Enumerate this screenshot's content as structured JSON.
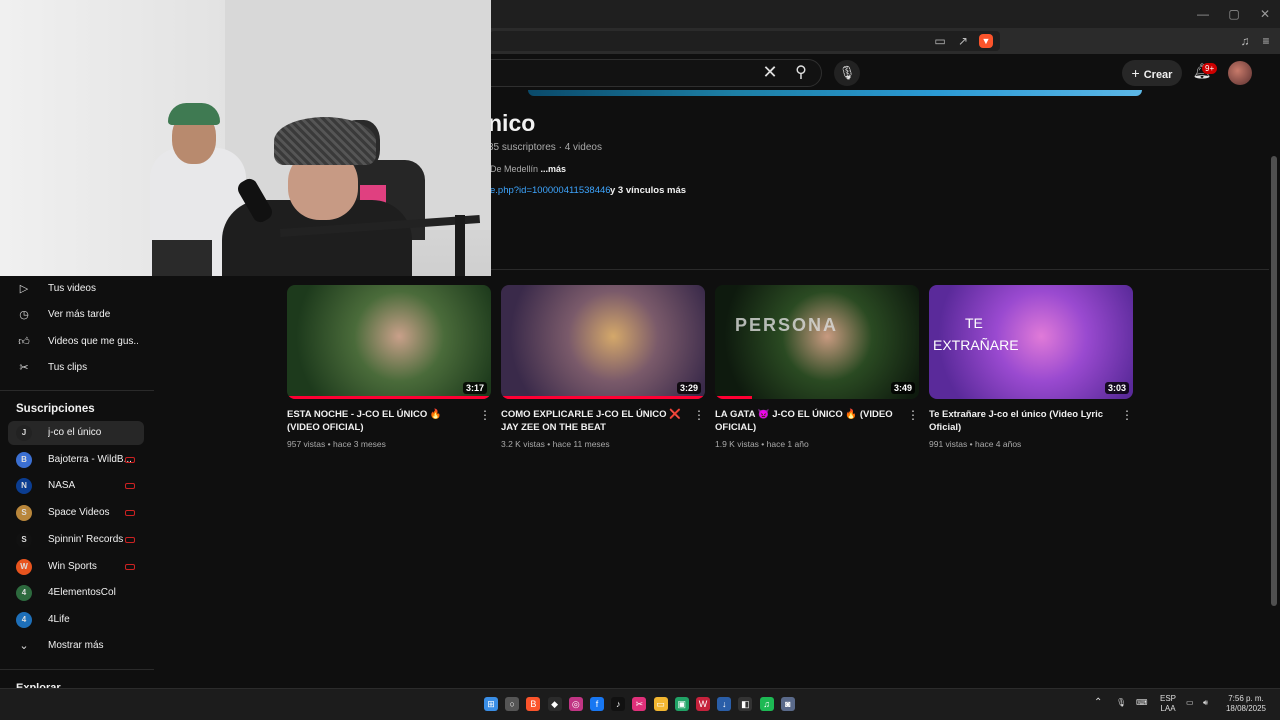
{
  "browser": {
    "window_controls": {
      "minimize": "—",
      "maximize": "▢",
      "close": "✕"
    }
  },
  "header": {
    "create_label": "Crear",
    "notifications_badge": "9+"
  },
  "channel": {
    "name": "nico",
    "stats": "35 suscriptores · 4 videos",
    "description": "De Medellín",
    "description_more": "...más",
    "link": "e.php?id=100000411538446",
    "more_links": "y 3 vínculos más"
  },
  "sidebar": {
    "items": [
      {
        "label": "Tus videos",
        "icon": "video-icon"
      },
      {
        "label": "Ver más tarde",
        "icon": "clock-icon"
      },
      {
        "label": "Videos que me gus...",
        "icon": "thumbs-up-icon"
      },
      {
        "label": "Tus clips",
        "icon": "scissors-icon"
      }
    ],
    "subscriptions_header": "Suscripciones",
    "subscriptions": [
      {
        "label": "j-co el único",
        "color": "#222222",
        "glyph": "J",
        "live": false,
        "active": true
      },
      {
        "label": "Bajoterra - WildB...",
        "color": "#3b6fd1",
        "glyph": "B",
        "live": true,
        "active": false
      },
      {
        "label": "NASA",
        "color": "#0b3d91",
        "glyph": "N",
        "live": true,
        "active": false
      },
      {
        "label": "Space Videos",
        "color": "#b8863b",
        "glyph": "S",
        "live": true,
        "active": false
      },
      {
        "label": "Spinnin' Records",
        "color": "#111111",
        "glyph": "S",
        "live": true,
        "active": false
      },
      {
        "label": "Win Sports",
        "color": "#e8541e",
        "glyph": "W",
        "live": true,
        "active": false
      },
      {
        "label": "4ElementosCol",
        "color": "#2d6a3e",
        "glyph": "4",
        "live": false,
        "active": false
      },
      {
        "label": "4Life",
        "color": "#1e6fb8",
        "glyph": "4",
        "live": false,
        "active": false
      }
    ],
    "show_more": "Mostrar más",
    "explore": "Explorar"
  },
  "videos": [
    {
      "title": "ESTA NOCHE - J-CO EL ÚNICO 🔥 (VIDEO OFICIAL)",
      "views": "957 vistas",
      "age": "hace 3 meses",
      "duration": "3:17",
      "progress": 1.0,
      "colors": [
        "#1d3a1c",
        "#4a6b3a",
        "#c9a08a"
      ]
    },
    {
      "title": "COMO EXPLICARLE J-CO EL ÚNICO ❌ JAY ZEE ON THE BEAT",
      "views": "3.2 K vistas",
      "age": "hace 11 meses",
      "duration": "3:29",
      "progress": 1.0,
      "colors": [
        "#3a2a4a",
        "#7a5a6a",
        "#d4a86a"
      ]
    },
    {
      "title": "LA GATA 👿 J-CO EL ÚNICO 🔥 (VIDEO OFICIAL)",
      "views": "1.9 K vistas",
      "age": "hace 1 año",
      "duration": "3:49",
      "progress": 0.18,
      "colors": [
        "#0e1a0e",
        "#2a4a22",
        "#c89a80"
      ]
    },
    {
      "title": "Te Extrañare J-co el único (Video Lyric Oficial)",
      "views": "991 vistas",
      "age": "hace 4 años",
      "duration": "3:03",
      "progress": 0,
      "colors": [
        "#5a2a9a",
        "#9a4ad0",
        "#e07ad8"
      ]
    }
  ],
  "thumbnail_text": {
    "v3": "PERSONA",
    "v4_line1": "TE",
    "v4_line2": "EXTRAÑARE"
  },
  "taskbar": {
    "icons": [
      {
        "name": "windows-start-icon",
        "color": "#3a8ee6",
        "glyph": "⊞"
      },
      {
        "name": "search-taskbar-icon",
        "color": "#555555",
        "glyph": "○"
      },
      {
        "name": "brave-icon",
        "color": "#fb542b",
        "glyph": "B"
      },
      {
        "name": "app-icon",
        "color": "#2b2b2b",
        "glyph": "◆"
      },
      {
        "name": "instagram-icon",
        "color": "#c13584",
        "glyph": "◎"
      },
      {
        "name": "facebook-icon",
        "color": "#1877f2",
        "glyph": "f"
      },
      {
        "name": "tiktok-icon",
        "color": "#111111",
        "glyph": "♪"
      },
      {
        "name": "capcut-icon",
        "color": "#e0307a",
        "glyph": "✂"
      },
      {
        "name": "files-icon",
        "color": "#f2b630",
        "glyph": "▭"
      },
      {
        "name": "store-icon",
        "color": "#21a366",
        "glyph": "▣"
      },
      {
        "name": "app-red-icon",
        "color": "#c6223c",
        "glyph": "W"
      },
      {
        "name": "app-blue-icon",
        "color": "#2a5ea8",
        "glyph": "↓"
      },
      {
        "name": "app-dark-icon",
        "color": "#333333",
        "glyph": "◧"
      },
      {
        "name": "spotify-icon",
        "color": "#1db954",
        "glyph": "♫"
      },
      {
        "name": "camera-icon",
        "color": "#5a6a8a",
        "glyph": "◙"
      }
    ],
    "lang": "ESP",
    "lang2": "LAA",
    "time": "7:56 p. m.",
    "date": "18/08/2025"
  }
}
